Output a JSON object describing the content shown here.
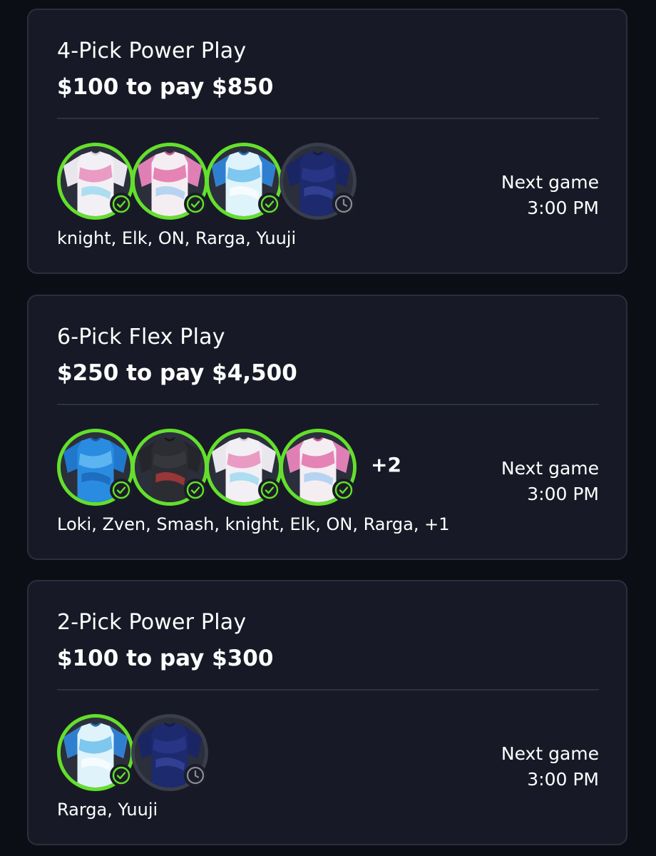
{
  "colors": {
    "background": "#0c0e16",
    "card": "#171a26",
    "card_border": "#2b2f3d",
    "win_ring": "#63e02b",
    "pending_ring": "#3a3d4a"
  },
  "entries": [
    {
      "title": "4-Pick Power Play",
      "payout": "$100 to pay $850",
      "picks": [
        {
          "jersey": "white-pink-jersey",
          "status": "won"
        },
        {
          "jersey": "pink-white-jersey",
          "status": "won"
        },
        {
          "jersey": "light-blue-jersey",
          "status": "won"
        },
        {
          "jersey": "navy-jersey",
          "status": "pending"
        }
      ],
      "more_label": "",
      "players": "knight, Elk, ON, Rarga, Yuuji",
      "next_game_label": "Next game",
      "next_game_time": "3:00 PM"
    },
    {
      "title": "6-Pick Flex Play",
      "payout": "$250 to pay $4,500",
      "picks": [
        {
          "jersey": "blue-pattern-jersey",
          "status": "won"
        },
        {
          "jersey": "black-jersey",
          "status": "won"
        },
        {
          "jersey": "white-pink-jersey",
          "status": "won"
        },
        {
          "jersey": "pink-white-jersey",
          "status": "won"
        }
      ],
      "more_label": "+2",
      "players": "Loki, Zven, Smash, knight, Elk, ON, Rarga, +1",
      "next_game_label": "Next game",
      "next_game_time": "3:00 PM"
    },
    {
      "title": "2-Pick Power Play",
      "payout": "$100 to pay $300",
      "picks": [
        {
          "jersey": "light-blue-jersey",
          "status": "won"
        },
        {
          "jersey": "navy-jersey",
          "status": "pending"
        }
      ],
      "more_label": "",
      "players": "Rarga, Yuuji",
      "next_game_label": "Next game",
      "next_game_time": "3:00 PM"
    }
  ]
}
